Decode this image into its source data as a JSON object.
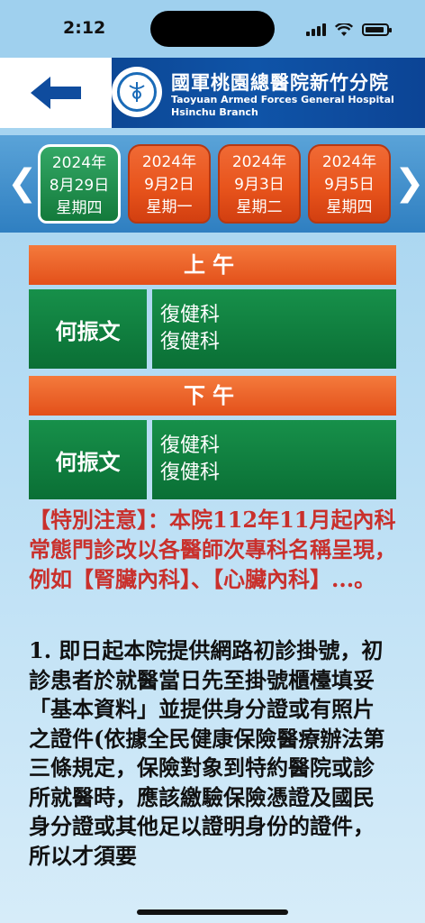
{
  "status": {
    "time": "2:12"
  },
  "header": {
    "hospital_zh": "國軍桃園總醫院新竹分院",
    "hospital_en_line1": "Taoyuan Armed Forces General Hospital",
    "hospital_en_line2": "Hsinchu Branch"
  },
  "dates": [
    {
      "year": "2024年",
      "date": "8月29日",
      "weekday": "星期四",
      "selected": true
    },
    {
      "year": "2024年",
      "date": "9月2日",
      "weekday": "星期一",
      "selected": false
    },
    {
      "year": "2024年",
      "date": "9月3日",
      "weekday": "星期二",
      "selected": false
    },
    {
      "year": "2024年",
      "date": "9月5日",
      "weekday": "星期四",
      "selected": false
    }
  ],
  "sessions": [
    {
      "label": "上午",
      "doctor": "何振文",
      "depts": [
        "復健科",
        "復健科"
      ]
    },
    {
      "label": "下午",
      "doctor": "何振文",
      "depts": [
        "復健科",
        "復健科"
      ]
    }
  ],
  "notice": "【特別注意】：本院112年11月起內科常態門診改以各醫師次專科名稱呈現，例如【腎臟內科】、【心臟內科】...。",
  "body": "1. 即日起本院提供網路初診掛號，初診患者於就醫當日先至掛號櫃檯填妥「基本資料」並提供身分證或有照片之證件(依據全民健康保險醫療辦法第三條規定，保險對象到特約醫院或診所就醫時，應該繳驗保險憑證及國民身分證或其他足以證明身份的證件，所以才須要"
}
